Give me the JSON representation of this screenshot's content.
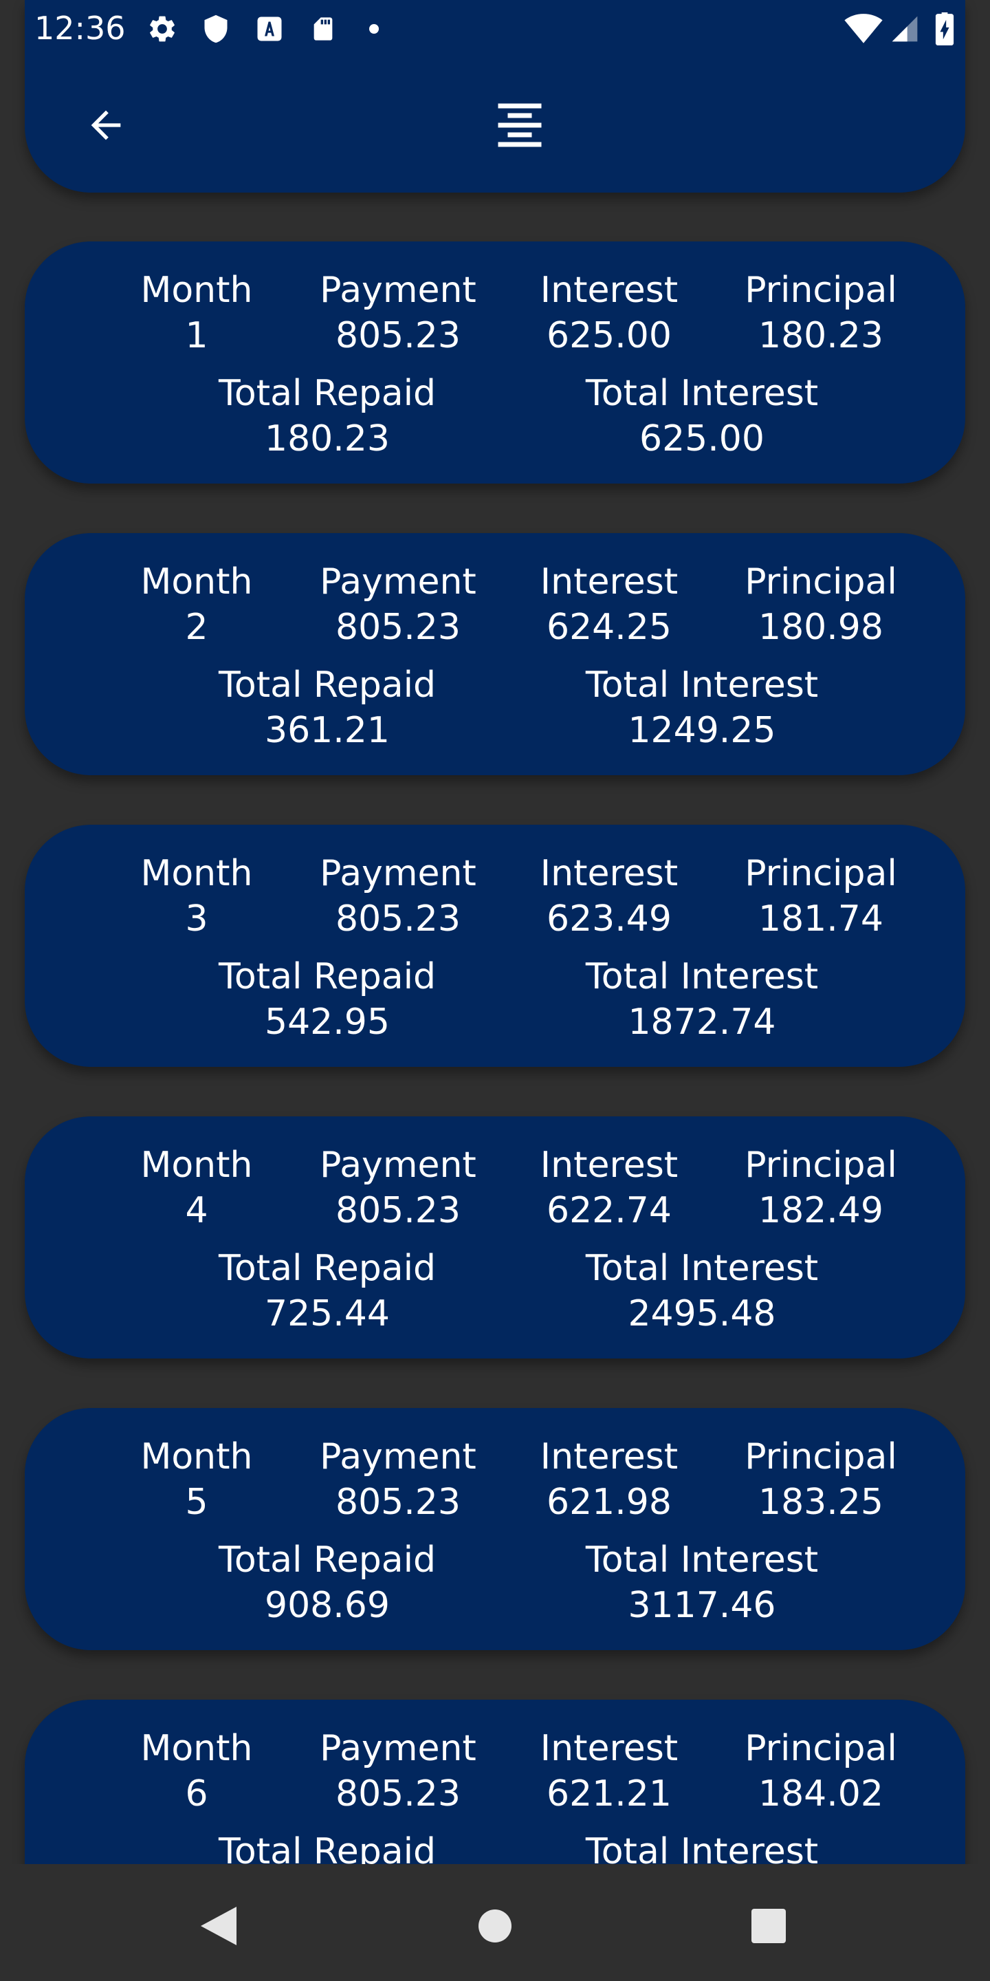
{
  "status_bar": {
    "time": "12:36",
    "icons": [
      "gear-icon",
      "shield-icon",
      "a-text-icon",
      "sd-card-icon",
      "dot-icon",
      "wifi-icon",
      "signal-icon",
      "battery-charging-icon"
    ]
  },
  "header": {
    "back_icon": "arrow-left-icon",
    "center_icon": "align-center-icon"
  },
  "labels": {
    "month": "Month",
    "payment": "Payment",
    "interest": "Interest",
    "principal": "Principal",
    "total_repaid": "Total Repaid",
    "total_interest": "Total Interest"
  },
  "schedule": [
    {
      "month": "1",
      "payment": "805.23",
      "interest": "625.00",
      "principal": "180.23",
      "total_repaid": "180.23",
      "total_interest": "625.00"
    },
    {
      "month": "2",
      "payment": "805.23",
      "interest": "624.25",
      "principal": "180.98",
      "total_repaid": "361.21",
      "total_interest": "1249.25"
    },
    {
      "month": "3",
      "payment": "805.23",
      "interest": "623.49",
      "principal": "181.74",
      "total_repaid": "542.95",
      "total_interest": "1872.74"
    },
    {
      "month": "4",
      "payment": "805.23",
      "interest": "622.74",
      "principal": "182.49",
      "total_repaid": "725.44",
      "total_interest": "2495.48"
    },
    {
      "month": "5",
      "payment": "805.23",
      "interest": "621.98",
      "principal": "183.25",
      "total_repaid": "908.69",
      "total_interest": "3117.46"
    },
    {
      "month": "6",
      "payment": "805.23",
      "interest": "621.21",
      "principal": "184.02",
      "total_repaid": "",
      "total_interest": ""
    }
  ],
  "nav_bar": {
    "icons": [
      "back-triangle-icon",
      "home-circle-icon",
      "recents-square-icon"
    ]
  },
  "colors": {
    "background": "#2f2f2f",
    "card": "#02275e",
    "text": "#ffffff"
  }
}
